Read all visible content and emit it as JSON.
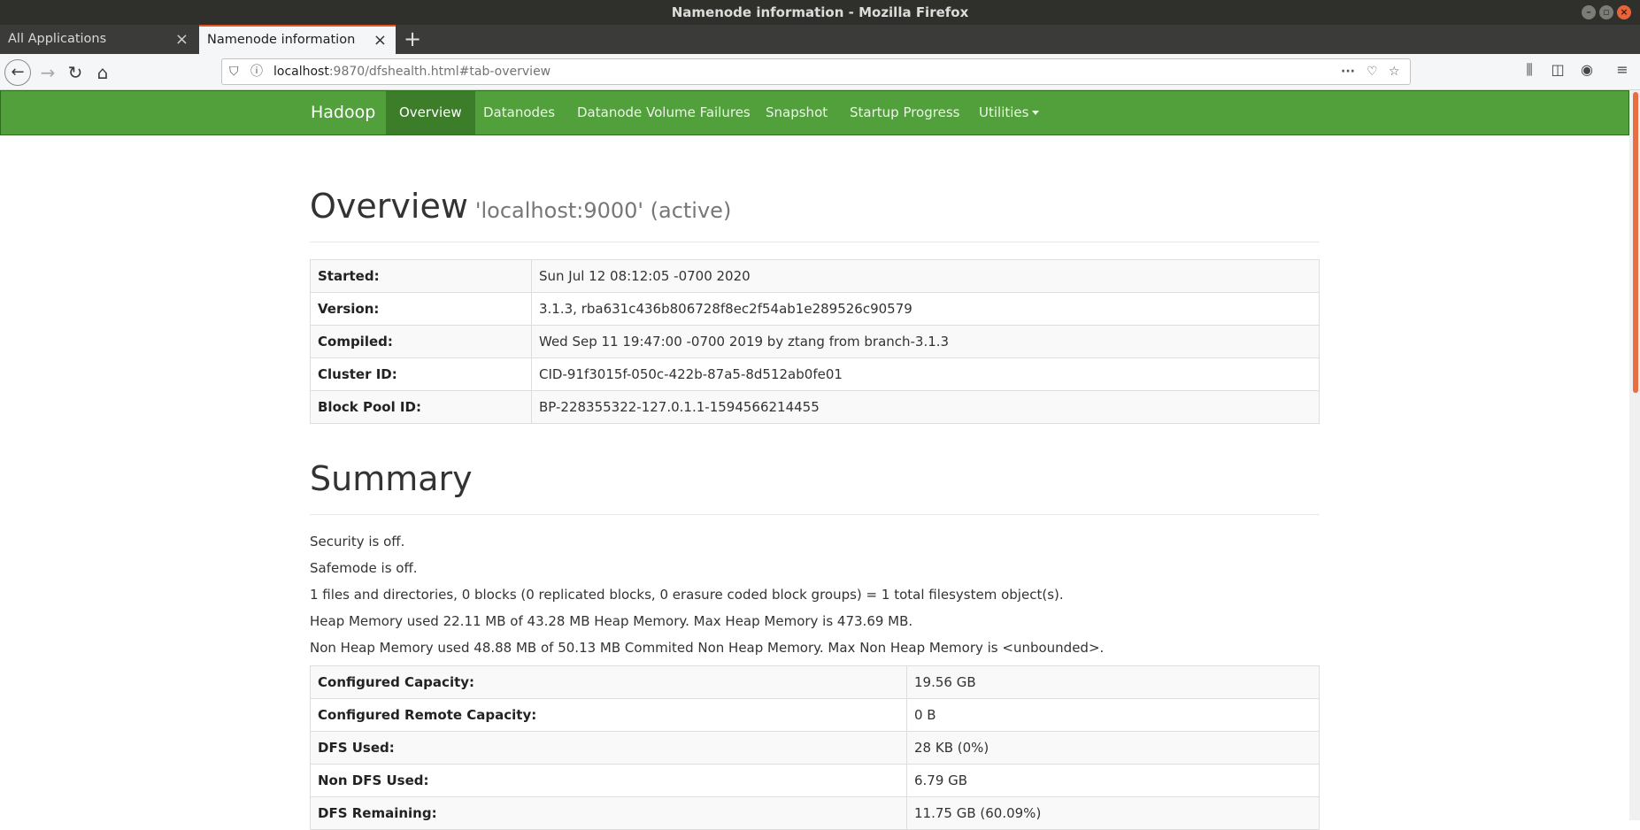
{
  "window": {
    "title": "Namenode information - Mozilla Firefox"
  },
  "tabs": [
    {
      "label": "All Applications"
    },
    {
      "label": "Namenode information"
    }
  ],
  "url": {
    "host": "localhost",
    "rest": ":9870/dfshealth.html#tab-overview"
  },
  "hadoop_nav": {
    "brand": "Hadoop",
    "items": [
      "Overview",
      "Datanodes",
      "Datanode Volume Failures",
      "Snapshot",
      "Startup Progress",
      "Utilities"
    ]
  },
  "overview": {
    "title": "Overview",
    "subtitle": "'localhost:9000' (active)",
    "rows": [
      {
        "key": "Started:",
        "value": "Sun Jul 12 08:12:05 -0700 2020"
      },
      {
        "key": "Version:",
        "value": "3.1.3, rba631c436b806728f8ec2f54ab1e289526c90579"
      },
      {
        "key": "Compiled:",
        "value": "Wed Sep 11 19:47:00 -0700 2019 by ztang from branch-3.1.3"
      },
      {
        "key": "Cluster ID:",
        "value": "CID-91f3015f-050c-422b-87a5-8d512ab0fe01"
      },
      {
        "key": "Block Pool ID:",
        "value": "BP-228355322-127.0.1.1-1594566214455"
      }
    ]
  },
  "summary": {
    "title": "Summary",
    "lines": [
      "Security is off.",
      "Safemode is off.",
      "1 files and directories, 0 blocks (0 replicated blocks, 0 erasure coded block groups) = 1 total filesystem object(s).",
      "Heap Memory used 22.11 MB of 43.28 MB Heap Memory. Max Heap Memory is 473.69 MB.",
      "Non Heap Memory used 48.88 MB of 50.13 MB Commited Non Heap Memory. Max Non Heap Memory is <unbounded>."
    ],
    "rows": [
      {
        "key": "Configured Capacity:",
        "value": "19.56 GB"
      },
      {
        "key": "Configured Remote Capacity:",
        "value": "0 B"
      },
      {
        "key": "DFS Used:",
        "value": "28 KB (0%)"
      },
      {
        "key": "Non DFS Used:",
        "value": "6.79 GB"
      },
      {
        "key": "DFS Remaining:",
        "value": "11.75 GB (60.09%)"
      }
    ]
  }
}
